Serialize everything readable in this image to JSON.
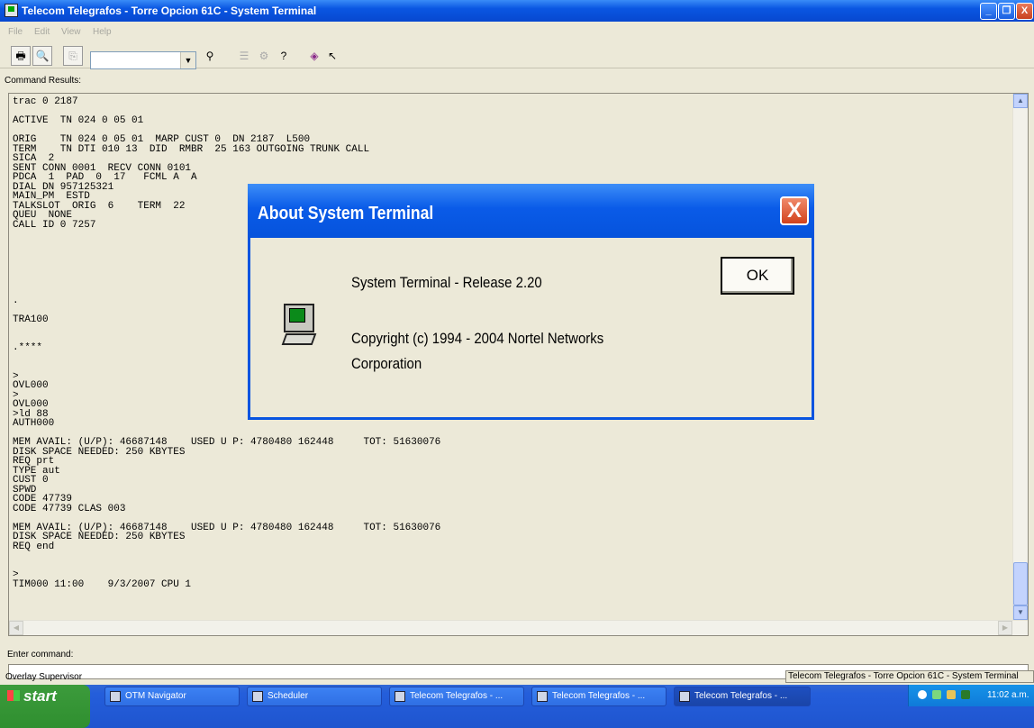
{
  "window": {
    "title": "Telecom Telegrafos - Torre Opcion 61C - System Terminal",
    "buttons": {
      "minimize": "_",
      "restore": "❐",
      "close": "X"
    }
  },
  "menubar": {
    "items": [
      "File",
      "Edit",
      "View",
      "Help"
    ]
  },
  "toolbar": {
    "icons": [
      "print-icon",
      "print-preview-icon",
      "copy-icon",
      "find-icon",
      "properties-icon",
      "tools-icon",
      "help-topics-icon",
      "book-icon",
      "context-help-icon"
    ],
    "combo_value": ""
  },
  "results": {
    "label": "Command Results:",
    "lines": [
      "trac 0 2187",
      "",
      "ACTIVE  TN 024 0 05 01",
      "",
      "ORIG    TN 024 0 05 01  MARP CUST 0  DN 2187  L500",
      "TERM    TN DTI 010 13  DID  RMBR  25 163 OUTGOING TRUNK CALL",
      "SICA  2",
      "SENT CONN 0001  RECV CONN 0101",
      "PDCA  1  PAD  0  17   FCML A  A",
      "DIAL DN 957125321",
      "MAIN_PM  ESTD",
      "TALKSLOT  ORIG  6    TERM  22",
      "QUEU  NONE",
      "CALL ID 0 7257",
      "",
      "",
      "",
      "",
      "",
      "",
      "",
      ".",
      "",
      "TRA100",
      "",
      "",
      ".****",
      "",
      "",
      ">",
      "OVL000",
      ">",
      "OVL000",
      ">ld 88",
      "AUTH000",
      "",
      "MEM AVAIL: (U/P): 46687148    USED U P: 4780480 162448     TOT: 51630076",
      "DISK SPACE NEEDED: 250 KBYTES",
      "REQ prt",
      "TYPE aut",
      "CUST 0",
      "SPWD",
      "CODE 47739",
      "CODE 47739 CLAS 003",
      "",
      "MEM AVAIL: (U/P): 46687148    USED U P: 4780480 162448     TOT: 51630076",
      "DISK SPACE NEEDED: 250 KBYTES",
      "REQ end",
      "",
      "",
      ">",
      "TIM000 11:00    9/3/2007 CPU 1"
    ]
  },
  "command": {
    "label": "Enter command:",
    "value": ""
  },
  "statusbar": {
    "left": "Overlay Supervisor",
    "right": "Telecom Telegrafos - Torre Opcion 61C - System Terminal"
  },
  "taskbar": {
    "start_label": "start",
    "tasks": [
      {
        "label": "OTM Navigator"
      },
      {
        "label": "Scheduler"
      },
      {
        "label": "Telecom Telegrafos - ..."
      },
      {
        "label": "Telecom Telegrafos - ..."
      },
      {
        "label": "Telecom Telegrafos - ..."
      }
    ],
    "clock": "11:02 a.m."
  },
  "dialog": {
    "title": "About System Terminal",
    "close": "X",
    "release": "System Terminal - Release 2.20",
    "copyright_line1": "Copyright (c) 1994 - 2004 Nortel Networks",
    "copyright_line2": "Corporation",
    "ok_label": "OK"
  }
}
